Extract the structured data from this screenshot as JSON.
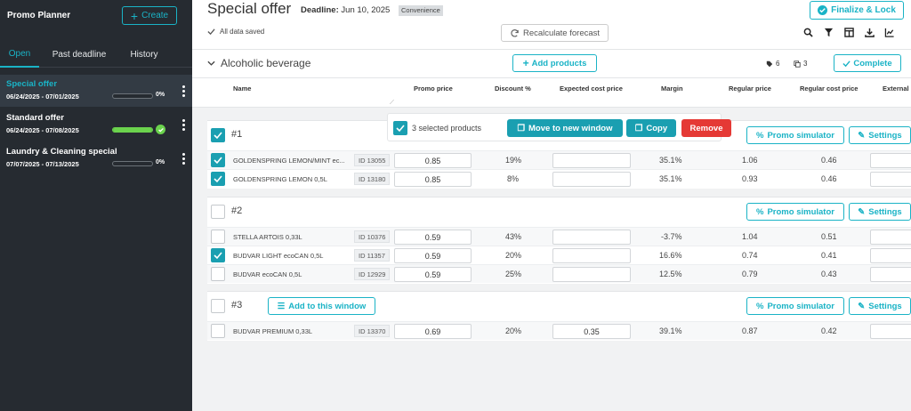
{
  "app": {
    "title": "Promo Planner",
    "create_label": "Create"
  },
  "sidebar": {
    "tabs": [
      {
        "label": "Open"
      },
      {
        "label": "Past deadline"
      },
      {
        "label": "History"
      }
    ],
    "promos": [
      {
        "name": "Special offer",
        "dates": "06/24/2025 - 07/01/2025",
        "progress": 0,
        "progress_label": "0%"
      },
      {
        "name": "Standard offer",
        "dates": "06/24/2025 - 07/08/2025",
        "progress": 100,
        "progress_label": ""
      },
      {
        "name": "Laundry & Cleaning special",
        "dates": "07/07/2025 - 07/13/2025",
        "progress": 0,
        "progress_label": "0%"
      }
    ]
  },
  "header": {
    "title": "Special offer",
    "deadline_label": "Deadline:",
    "deadline_value": "Jun 10, 2025",
    "tag": "Convenience",
    "finalize_label": "Finalize & Lock",
    "saved_text": "All data saved",
    "recalc_label": "Recalculate forecast"
  },
  "section": {
    "title": "Alcoholic beverage",
    "add_products_label": "Add products",
    "tag_count": "6",
    "copy_count": "3",
    "complete_label": "Complete"
  },
  "columns": [
    "Name",
    "Promo price",
    "Discount %",
    "Expected cost price",
    "Margin",
    "Regular price",
    "Regular cost price",
    "External"
  ],
  "selection": {
    "text": "3 selected products",
    "move_label": "Move to new window",
    "copy_label": "Copy",
    "remove_label": "Remove"
  },
  "window_actions": {
    "simulator_label": "Promo simulator",
    "settings_label": "Settings",
    "add_label": "Add to this window"
  },
  "windows": [
    {
      "num": "#1",
      "rows": [
        {
          "name": "GOLDENSPRING LEMON/MINT ec...",
          "id": "ID 13055",
          "promo": "0.85",
          "discount": "19%",
          "exp_cost": "",
          "margin": "35.1%",
          "reg_price": "1.06",
          "reg_cost": "0.46"
        },
        {
          "name": "GOLDENSPRING LEMON 0,5L",
          "id": "ID 13180",
          "promo": "0.85",
          "discount": "8%",
          "exp_cost": "",
          "margin": "35.1%",
          "reg_price": "0.93",
          "reg_cost": "0.46"
        }
      ]
    },
    {
      "num": "#2",
      "rows": [
        {
          "name": "STELLA ARTOIS 0,33L",
          "id": "ID 10376",
          "promo": "0.59",
          "discount": "43%",
          "exp_cost": "",
          "margin": "-3.7%",
          "reg_price": "1.04",
          "reg_cost": "0.51"
        },
        {
          "name": "BUDVAR LIGHT ecoCAN 0,5L",
          "id": "ID 11357",
          "promo": "0.59",
          "discount": "20%",
          "exp_cost": "",
          "margin": "16.6%",
          "reg_price": "0.74",
          "reg_cost": "0.41"
        },
        {
          "name": "BUDVAR ecoCAN 0,5L",
          "id": "ID 12929",
          "promo": "0.59",
          "discount": "25%",
          "exp_cost": "",
          "margin": "12.5%",
          "reg_price": "0.79",
          "reg_cost": "0.43"
        }
      ]
    },
    {
      "num": "#3",
      "rows": [
        {
          "name": "BUDVAR PREMIUM 0,33L",
          "id": "ID 13370",
          "promo": "0.69",
          "discount": "20%",
          "exp_cost": "0.35",
          "margin": "39.1%",
          "reg_price": "0.87",
          "reg_cost": "0.42"
        }
      ]
    }
  ],
  "colors": {
    "accent": "#1ab3c6",
    "sidebar_bg": "#262b31",
    "success": "#6bd34d",
    "danger": "#e53935",
    "primary_btn": "#1a9fb1"
  }
}
